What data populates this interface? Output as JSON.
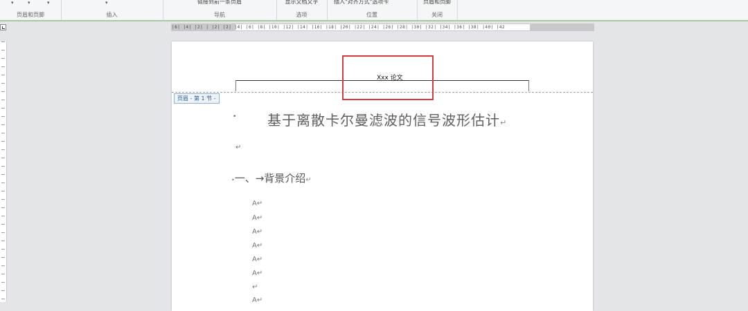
{
  "ribbon": {
    "groups": [
      {
        "name": "页眉和页脚"
      },
      {
        "name": "插入"
      },
      {
        "name": "导航",
        "control": "链接到前一条页眉"
      },
      {
        "name": "选项",
        "control": "显示文档文字"
      },
      {
        "name": "位置",
        "control": "插入\"对齐方式\"选项卡"
      },
      {
        "name": "关闭",
        "control": "页眉和页脚"
      }
    ]
  },
  "ruler": {
    "ticks": "|6| |4| |2| | |2| |2| |4| |6| |8| |10| |12| |14| |16| |18| |20| |22| |24| |26| |28| |30| |32| |34| |36| |38| |40| |42"
  },
  "page": {
    "header_text": "Xxx 论文",
    "header_tag": "页眉 - 第 1 节 -",
    "title": "基于离散卡尔曼滤波的信号波形估计",
    "title_mark": "↵",
    "empty_paragraph_mark": "↵",
    "section_heading": "一、→背景介绍",
    "section_mark": "↵",
    "body_lines": [
      "A↵",
      "A↵",
      "A↵",
      "A↵",
      "A↵",
      "A↵",
      "↵",
      "A↵"
    ]
  },
  "colors": {
    "highlight_box": "#d43b3b",
    "ribbon_accent": "#a9c6a5",
    "header_tag_text": "#2f5f92"
  }
}
